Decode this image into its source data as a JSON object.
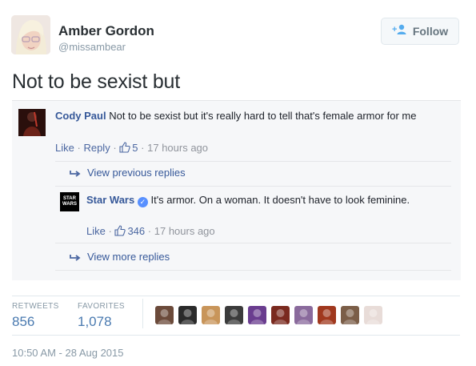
{
  "user": {
    "name": "Amber Gordon",
    "handle": "@missambear"
  },
  "follow_button": {
    "label": "Follow",
    "icon": "person-add-icon",
    "color": "#55acee"
  },
  "tweet": {
    "text": "Not to be sexist but"
  },
  "embedded": {
    "comment1": {
      "author": "Cody Paul",
      "text": "Not to be sexist but it's really hard to tell that's female armor for me",
      "like": "Like",
      "reply": "Reply",
      "sep": "·",
      "likes": "5",
      "time": "17 hours ago"
    },
    "view_previous": "View previous replies",
    "comment2": {
      "author": "Star Wars",
      "avatar_text": "STAR WARS",
      "text": "It's armor. On a woman. It doesn't have to look feminine.",
      "like": "Like",
      "sep": "·",
      "likes": "346",
      "time": "17 hours ago"
    },
    "view_more": "View more replies"
  },
  "stats": {
    "retweets_label": "RETWEETS",
    "retweets": "856",
    "favorites_label": "FAVORITES",
    "favorites": "1,078"
  },
  "favoriters": [
    {
      "name": "favoriter-avatar-1",
      "color": "#6b4a3a"
    },
    {
      "name": "favoriter-avatar-2",
      "color": "#2a2a2a"
    },
    {
      "name": "favoriter-avatar-3",
      "color": "#c8955a"
    },
    {
      "name": "favoriter-avatar-4",
      "color": "#3b3b3b"
    },
    {
      "name": "favoriter-avatar-5",
      "color": "#6a3d8f"
    },
    {
      "name": "favoriter-avatar-6",
      "color": "#7a2a1f"
    },
    {
      "name": "favoriter-avatar-7",
      "color": "#8a6a9c"
    },
    {
      "name": "favoriter-avatar-8",
      "color": "#a0381e"
    },
    {
      "name": "favoriter-avatar-9",
      "color": "#7b5e48"
    },
    {
      "name": "favoriter-avatar-10",
      "color": "#e8dcd8"
    }
  ],
  "timestamp": "10:50 AM - 28 Aug 2015"
}
